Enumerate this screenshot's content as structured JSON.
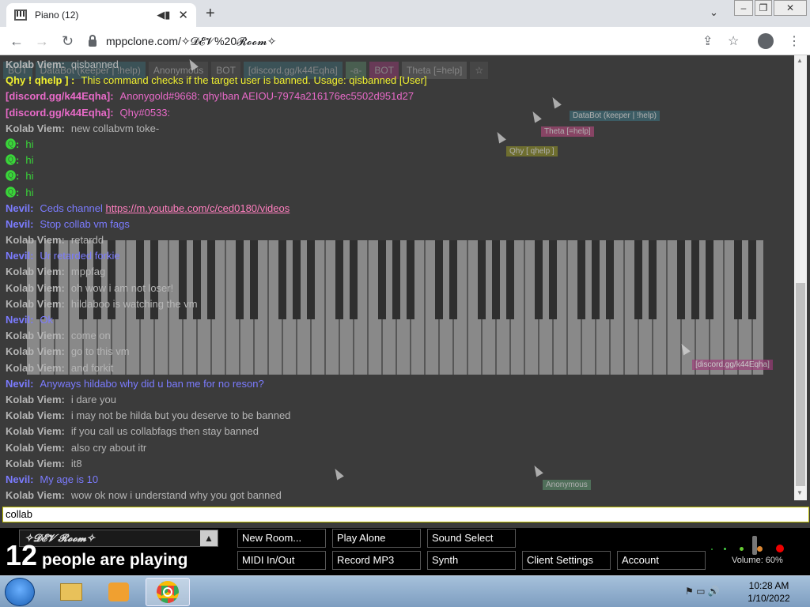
{
  "browser": {
    "tab_title": "Piano (12)",
    "url": "mppclone.com/✧𝓓𝓔𝓥%20𝓡𝓸𝓸𝓶✧"
  },
  "notes_tags": [
    "BOT",
    "DataBot (keeper | !help)",
    "Anonymous",
    "BOT",
    "[discord.gg/k44Eqha]",
    "-a-",
    "BOT",
    "Theta [=help]",
    "☆"
  ],
  "cursor_tags": [
    "DataBot (keeper | !help)",
    "Theta [=help]",
    "Qhy [ qhelp ]",
    "[discord.gg/k44Eqha]",
    "Anonymous"
  ],
  "messages": [
    {
      "name": "Kolab Viem:",
      "text": "qisbanned",
      "name_color": "#b5b5b5",
      "text_color": "#b5b5b5"
    },
    {
      "name": "Qhy ! qhelp ] :",
      "text": "This command checks if the target user is banned. Usage: qisbanned [User]",
      "name_color": "#f2f230",
      "text_color": "#f2f230"
    },
    {
      "name": "[discord.gg/k44Eqha]:",
      "text": "Anonygold#9668: qhy!ban AEIOU-7974a216176ec5502d951d27",
      "name_color": "#e86ac8",
      "text_color": "#e86ac8"
    },
    {
      "name": "[discord.gg/k44Eqha]:",
      "text": "Qhy#0533:",
      "name_color": "#e86ac8",
      "text_color": "#e86ac8"
    },
    {
      "name": "Kolab Viem:",
      "text": "new collabvm toke-",
      "name_color": "#b5b5b5",
      "text_color": "#b5b5b5"
    },
    {
      "name": "🅠:",
      "text": "hi",
      "name_color": "#39d639",
      "text_color": "#39d639"
    },
    {
      "name": "🅠:",
      "text": "hi",
      "name_color": "#39d639",
      "text_color": "#39d639"
    },
    {
      "name": "🅠:",
      "text": "hi",
      "name_color": "#39d639",
      "text_color": "#39d639"
    },
    {
      "name": "🅠:",
      "text": "hi",
      "name_color": "#39d639",
      "text_color": "#39d639"
    },
    {
      "name": "Nevil:",
      "text": "Ceds channel",
      "link": "https://m.youtube.com/c/ced0180/videos",
      "name_color": "#7b7bff",
      "text_color": "#7b7bff"
    },
    {
      "name": "Nevil:",
      "text": "Stop collab vm fags",
      "name_color": "#7b7bff",
      "text_color": "#7b7bff"
    },
    {
      "name": "Kolab Viem:",
      "text": "retardd",
      "name_color": "#b5b5b5",
      "text_color": "#b5b5b5"
    },
    {
      "name": "Nevil:",
      "text": "Ur retarded forkie",
      "name_color": "#7b7bff",
      "text_color": "#7b7bff"
    },
    {
      "name": "Kolab Viem:",
      "text": "mppfag",
      "name_color": "#b5b5b5",
      "text_color": "#b5b5b5"
    },
    {
      "name": "Kolab Viem:",
      "text": "oh wow i am not loser!",
      "name_color": "#b5b5b5",
      "text_color": "#b5b5b5"
    },
    {
      "name": "Kolab Viem:",
      "text": "hildaboo is watching the vm",
      "name_color": "#b5b5b5",
      "text_color": "#b5b5b5"
    },
    {
      "name": "Nevil:",
      "text": "Ok",
      "name_color": "#7b7bff",
      "text_color": "#7b7bff"
    },
    {
      "name": "Kolab Viem:",
      "text": "come on",
      "name_color": "#b5b5b5",
      "text_color": "#b5b5b5"
    },
    {
      "name": "Kolab Viem:",
      "text": "go to this vm",
      "name_color": "#b5b5b5",
      "text_color": "#b5b5b5"
    },
    {
      "name": "Kolab Viem:",
      "text": "and forkit",
      "name_color": "#b5b5b5",
      "text_color": "#b5b5b5"
    },
    {
      "name": "Nevil:",
      "text": "Anyways hildabo why did u ban me for no reson?",
      "name_color": "#7b7bff",
      "text_color": "#7b7bff"
    },
    {
      "name": "Kolab Viem:",
      "text": "i dare you",
      "name_color": "#b5b5b5",
      "text_color": "#b5b5b5"
    },
    {
      "name": "Kolab Viem:",
      "text": "i may not be hilda but you deserve to be banned",
      "name_color": "#b5b5b5",
      "text_color": "#b5b5b5"
    },
    {
      "name": "Kolab Viem:",
      "text": "if you call us collabfags then stay banned",
      "name_color": "#b5b5b5",
      "text_color": "#b5b5b5"
    },
    {
      "name": "Kolab Viem:",
      "text": "also cry about itr",
      "name_color": "#b5b5b5",
      "text_color": "#b5b5b5"
    },
    {
      "name": "Kolab Viem:",
      "text": "it8",
      "name_color": "#b5b5b5",
      "text_color": "#b5b5b5"
    },
    {
      "name": "Nevil:",
      "text": "My age is 10",
      "name_color": "#7b7bff",
      "text_color": "#7b7bff"
    },
    {
      "name": "Kolab Viem:",
      "text": "wow ok now i understand why you got banned",
      "name_color": "#b5b5b5",
      "text_color": "#b5b5b5"
    }
  ],
  "chat_input": {
    "value": "collab"
  },
  "room": {
    "name": "✧𝓓𝓔𝓥 𝓡𝓸𝓸𝓶✧"
  },
  "people": {
    "count": "12",
    "label": "people are playing"
  },
  "buttons": {
    "new_room": "New Room...",
    "play_alone": "Play Alone",
    "sound_select": "Sound Select",
    "midi": "MIDI In/Out",
    "record": "Record MP3",
    "synth": "Synth",
    "client_settings": "Client Settings",
    "account": "Account"
  },
  "volume": {
    "label": "Volume: 60%",
    "level": 0.6
  },
  "clock": {
    "time": "10:28 AM",
    "date": "1/10/2022"
  },
  "colors": {
    "chat_bg": "#3b3b3b",
    "accent_input_border": "#bdbd00"
  }
}
